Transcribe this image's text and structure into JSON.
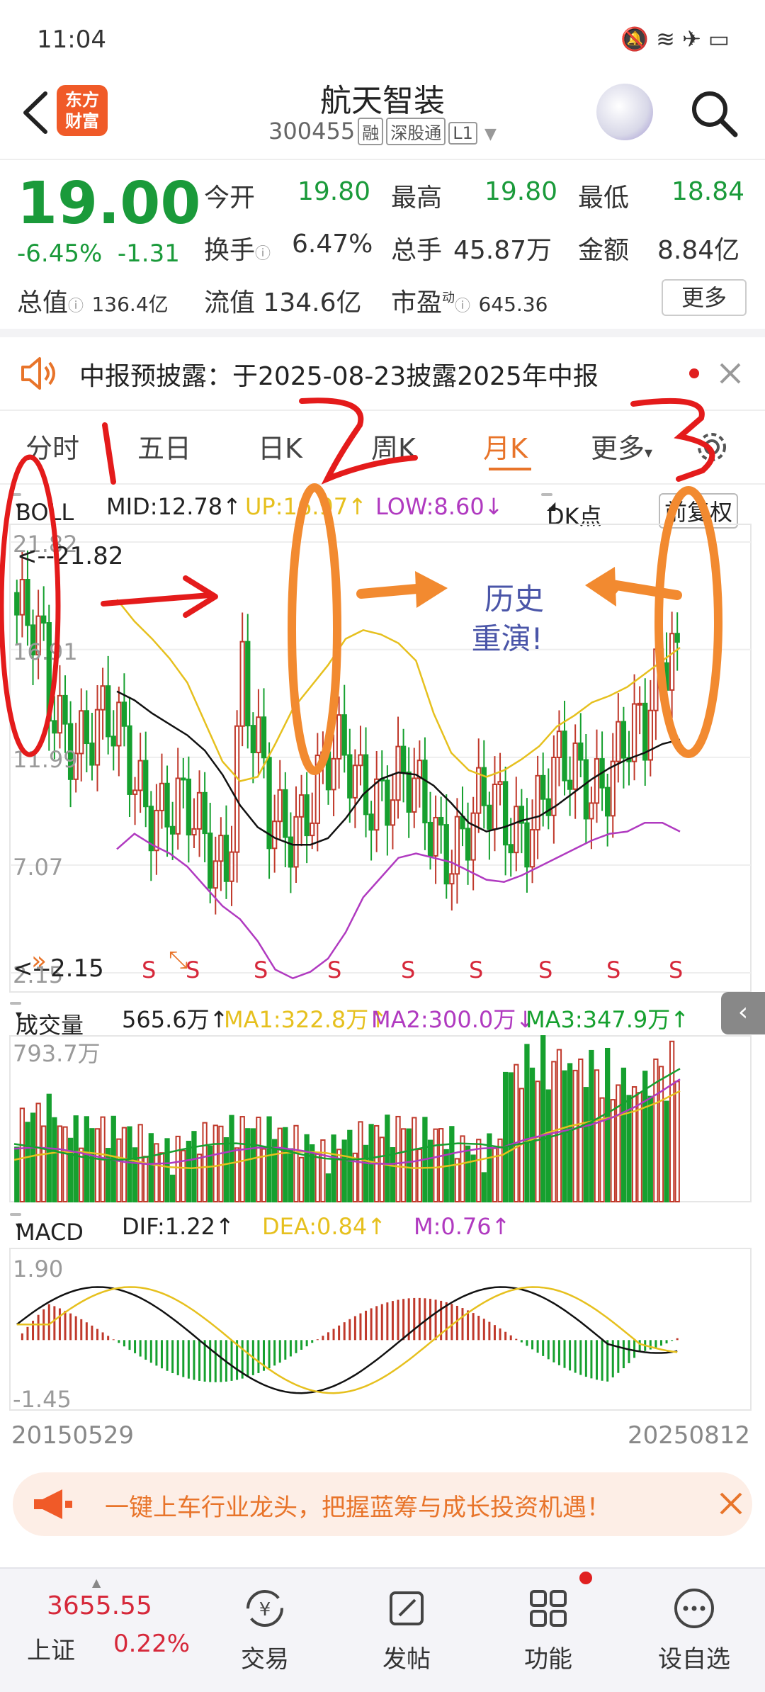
{
  "status_bar": {
    "time": "11:04"
  },
  "header": {
    "logo_text_1": "东方",
    "logo_text_2": "财富",
    "title": "航天智装",
    "code": "300455",
    "tags": [
      "融",
      "深股通",
      "L1"
    ]
  },
  "quote": {
    "price": "19.00",
    "change_pct": "-6.45%",
    "change": "-1.31",
    "open_label": "今开",
    "open": "19.80",
    "high_label": "最高",
    "high": "19.80",
    "low_label": "最低",
    "low": "18.84",
    "turnover_label": "换手",
    "turnover": "6.47%",
    "volume_label": "总手",
    "volume": "45.87万",
    "amount_label": "金额",
    "amount": "8.84亿",
    "mktcap_label": "总值",
    "mktcap": "136.4亿",
    "float_label": "流值",
    "float_cap": "134.6亿",
    "pe_label": "市盈",
    "pe_sup": "动",
    "pe": "645.36",
    "more_label": "更多"
  },
  "notice": {
    "text": "中报预披露：于2025-08-23披露2025年中报"
  },
  "tabs": [
    {
      "label": "分时"
    },
    {
      "label": "五日"
    },
    {
      "label": "日K"
    },
    {
      "label": "周K"
    },
    {
      "label": "月K"
    },
    {
      "label": "更多"
    }
  ],
  "boll_row": {
    "selector": "BOLL",
    "mid": "MID:12.78↑",
    "up": "UP:16.97↑",
    "low": "LOW:8.60↓",
    "dk_btn": "DK点",
    "rights_btn": "前复权"
  },
  "kline": {
    "y_labels": [
      "21.82",
      "16.91",
      "11.99",
      "7.07",
      "2.15"
    ],
    "max_marker": "<--21.82",
    "min_marker": "<--2.15",
    "s_marker": "S",
    "annotation_line1": "历史",
    "annotation_line2": "重演!"
  },
  "volume_row": {
    "selector": "成交量",
    "value": "565.6万↑",
    "ma1": "MA1:322.8万↑",
    "ma2": "MA2:300.0万↓",
    "ma3": "MA3:347.9万↑",
    "max_label": "793.7万"
  },
  "macd_row": {
    "selector": "MACD",
    "dif": "DIF:1.22↑",
    "dea": "DEA:0.84↑",
    "m": "M:0.76↑",
    "top_label": "1.90",
    "bottom_label": "-1.45"
  },
  "dates": {
    "start": "20150529",
    "end": "20250812"
  },
  "promo": {
    "text": "一键上车行业龙头，把握蓝筹与成长投资机遇！"
  },
  "bottom_nav": {
    "index_value": "3655.55",
    "index_name": "上证",
    "index_change": "0.22%",
    "items": [
      {
        "label": "交易",
        "icon": "yen-exchange-icon"
      },
      {
        "label": "发帖",
        "icon": "edit-icon"
      },
      {
        "label": "功能",
        "icon": "grid-icon"
      },
      {
        "label": "设自选",
        "icon": "more-dots-icon"
      }
    ]
  },
  "colors": {
    "up": "#c0392b",
    "down": "#16a02f",
    "mid_line": "#111111",
    "up_line": "#e6c01e",
    "low_line": "#b03ac0",
    "accent": "#e8742a"
  },
  "chart_data": [
    {
      "type": "candlestick",
      "title": "航天智装 月K",
      "y_ticks": [
        21.82,
        16.91,
        11.99,
        7.07,
        2.15
      ],
      "ylim": [
        2.15,
        21.82
      ],
      "x_range": [
        "20150529",
        "20250812"
      ],
      "series": [
        {
          "name": "MID",
          "values": [
            15.0,
            14.6,
            14.0,
            13.5,
            13.0,
            12.3,
            11.2,
            9.8,
            8.8,
            8.3,
            8.0,
            8.0,
            8.3,
            9.2,
            10.3,
            11.0,
            11.3,
            11.2,
            10.7,
            9.9,
            9.0,
            8.6,
            8.8,
            9.1,
            9.3,
            9.8,
            10.4,
            11.0,
            11.5,
            11.9,
            12.2,
            12.6,
            12.8
          ]
        },
        {
          "name": "UP",
          "values": [
            19.2,
            18.2,
            17.4,
            16.5,
            15.4,
            13.6,
            11.8,
            10.9,
            11.1,
            12.6,
            14.2,
            15.2,
            16.2,
            17.4,
            17.8,
            17.6,
            17.2,
            16.4,
            14.0,
            12.2,
            11.4,
            11.1,
            11.4,
            11.9,
            12.5,
            13.4,
            13.9,
            14.5,
            14.8,
            15.2,
            15.8,
            16.4,
            17.0
          ]
        },
        {
          "name": "LOW",
          "values": [
            7.8,
            8.5,
            8.0,
            7.6,
            7.0,
            6.1,
            5.2,
            4.6,
            3.6,
            2.3,
            1.9,
            2.2,
            2.8,
            4.0,
            5.6,
            6.5,
            7.4,
            7.6,
            7.4,
            7.2,
            6.8,
            6.4,
            6.3,
            6.6,
            7.0,
            7.4,
            7.8,
            8.2,
            8.5,
            8.6,
            9.0,
            9.0,
            8.6
          ]
        }
      ]
    },
    {
      "type": "bar",
      "title": "成交量",
      "ylim": [
        0,
        793.7
      ],
      "series": [
        {
          "name": "MA1",
          "value": 322.8
        },
        {
          "name": "MA2",
          "value": 300.0
        },
        {
          "name": "MA3",
          "value": 347.9
        }
      ],
      "last_value": 565.6
    },
    {
      "type": "line",
      "title": "MACD",
      "ylim": [
        -1.45,
        1.9
      ],
      "series": [
        {
          "name": "DIF",
          "value": 1.22
        },
        {
          "name": "DEA",
          "value": 0.84
        },
        {
          "name": "M",
          "value": 0.76
        }
      ]
    }
  ]
}
